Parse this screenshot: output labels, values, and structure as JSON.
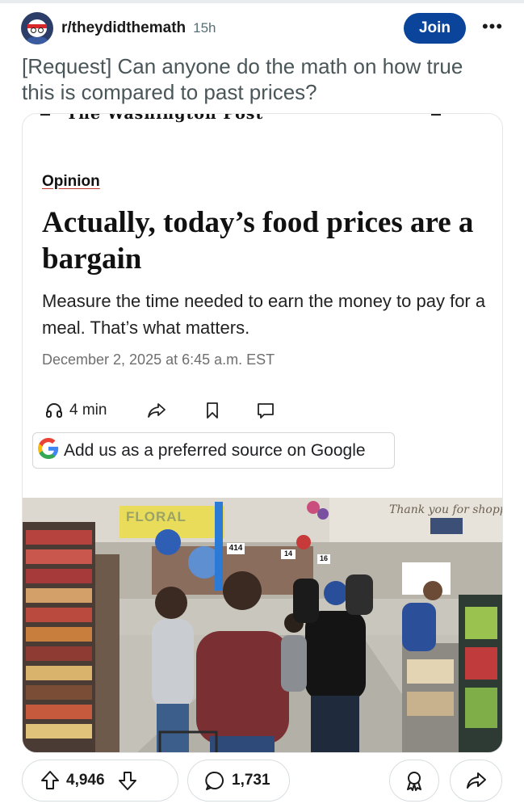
{
  "post": {
    "subreddit": "r/theydidthemath",
    "age": "15h",
    "join_label": "Join",
    "more_label": "•••",
    "title": "[Request] Can anyone do the math on how true this is compared to past prices?"
  },
  "article": {
    "masthead": "The Washington Post",
    "section": "Opinion",
    "headline": "Actually, today’s food prices are a bargain",
    "deck": "Measure the time needed to earn the money to pay for a meal. That’s what matters.",
    "dateline": "December 2, 2025 at 6:45 a.m. EST",
    "listen_label": "4 min",
    "google_cta": "Add us as a preferred source on Google",
    "photo": {
      "store_sign": "FLORAL",
      "wall_text": "Thank you for shoppi",
      "price_tags": [
        "414",
        "14",
        "16"
      ]
    }
  },
  "actions": {
    "upvotes": "4,946",
    "comments": "1,731"
  },
  "colors": {
    "join_button": "#0a449b",
    "title_text": "#4a5659",
    "meta_text": "#576f76",
    "opinion_underline": "#c0392b"
  },
  "icons": [
    "subreddit-avatar-icon",
    "more-icon",
    "headphones-icon",
    "share-arrow-icon",
    "bookmark-icon",
    "comment-icon",
    "google-g-icon",
    "upvote-icon",
    "downvote-icon",
    "comment-bubble-icon",
    "award-icon",
    "share-icon"
  ]
}
